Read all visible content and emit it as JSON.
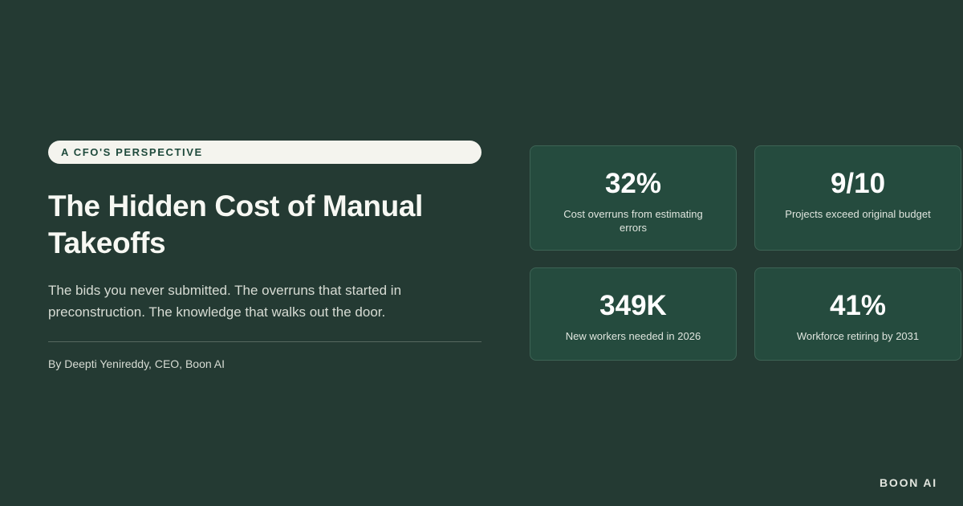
{
  "hero": {
    "eyebrow": "A CFO'S PERSPECTIVE",
    "title": "The Hidden Cost of Manual Takeoffs",
    "subtitle": "The bids you never submitted. The overruns that started in preconstruction. The knowledge that walks out the door.",
    "byline": "By Deepti Yenireddy, CEO, Boon AI"
  },
  "stats": [
    {
      "value": "32%",
      "label": "Cost overruns from estimating errors"
    },
    {
      "value": "9/10",
      "label": "Projects exceed original budget"
    },
    {
      "value": "349K",
      "label": "New workers needed in 2026"
    },
    {
      "value": "41%",
      "label": "Workforce retiring by 2031"
    }
  ],
  "brand": {
    "name": "BOON AI"
  },
  "colors": {
    "background": "#243a33",
    "card": "#254b3e",
    "pill": "#f4f4ee",
    "accent_text": "#1f4a3c"
  }
}
